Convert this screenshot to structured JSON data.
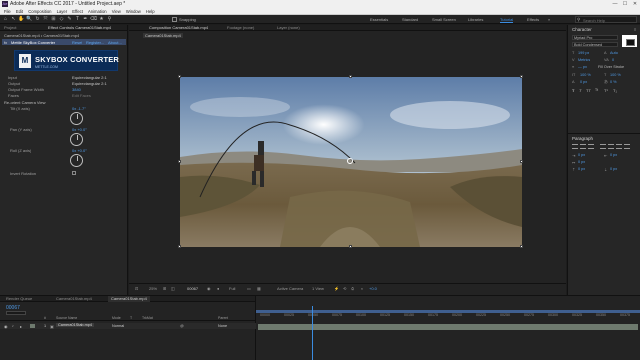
{
  "app": {
    "title": "Adobe After Effects CC 2017 - Untitled Project.aep *",
    "window_controls": [
      "—",
      "☐",
      "✕"
    ]
  },
  "menu": [
    "File",
    "Edit",
    "Composition",
    "Layer",
    "Effect",
    "Animation",
    "View",
    "Window",
    "Help"
  ],
  "toolbar": {
    "tools": [
      "⌂",
      "↖",
      "✋",
      "🔍",
      "↻",
      "⤧",
      "⊞",
      "◇",
      "✎",
      "T",
      "✒",
      "⌫",
      "★",
      "⚲"
    ],
    "snapping_label": "Snapping",
    "workspaces": [
      "Essentials",
      "Standard",
      "Small Screen",
      "Libraries",
      "Tutorial",
      "Effects"
    ],
    "active_workspace": "Tutorial",
    "search_placeholder": "Search Help"
  },
  "left_panel": {
    "tabs": [
      "Project",
      "Effect Controls  Camera01Stab.mp4"
    ],
    "breadcrumb": "Camera01Stab.mp4 • Camera01Stab.mp4",
    "effect_row": {
      "fx_label": "fx",
      "name": "Mettle SkyBox Converter",
      "reset": "Reset",
      "register": "Register...",
      "about": "About..."
    },
    "banner": {
      "title": "SKYBOX CONVERTER",
      "subtitle": "METTLE.COM"
    },
    "props": [
      {
        "label": "Input",
        "value": "Equirectangular 2:1"
      },
      {
        "label": "Output",
        "value": "Equirectangular 2:1"
      },
      {
        "label": "Output Frame Width",
        "value": "3840"
      },
      {
        "label": "Faces",
        "value": "Edit Faces"
      }
    ],
    "rotate": {
      "group_label": "Re-orient Camera View",
      "tilt_label": "Tilt (X axis)",
      "tilt_value": "0x -1.7°",
      "pan_label": "Pan (Y axis)",
      "pan_value": "0x +0.0°",
      "roll_label": "Roll (Z axis)",
      "roll_value": "0x +0.0°",
      "invert_label": "Invert Rotation"
    }
  },
  "viewer": {
    "tabs": [
      "Composition  Camera01Stab.mp4",
      "Footage (none)",
      "Layer (none)"
    ],
    "sub_tab": "Camera01Stab.mp4",
    "footer": {
      "zoom": "25%",
      "timecode": "00067",
      "resolution": "Full",
      "camera": "Active Camera",
      "views": "1 View",
      "exposure": "+0.0"
    }
  },
  "right_panel": {
    "character": {
      "title": "Character",
      "font": "Myriad Pro",
      "style": "Bold Condensed",
      "size": "199 px",
      "leading": "Auto",
      "tracking": "Metrics",
      "kerning": "0",
      "stroke": "— px",
      "stroke_mode": "Fill Over Stroke",
      "vscale": "100 %",
      "hscale": "100 %",
      "baseline": "0 px",
      "tsume": "0 %"
    },
    "paragraph": {
      "title": "Paragraph",
      "indent1": "0 px",
      "indent2": "0 px",
      "indent3": "0 px",
      "space1": "0 px",
      "space2": "0 px"
    }
  },
  "timeline": {
    "tabs": [
      "Render Queue",
      "Camera01Stab.mp4",
      "Camera01Stab.mp4"
    ],
    "timecode": "00067",
    "columns": [
      "#",
      "Source Name",
      "Mode",
      "T",
      "TrkMat",
      "Parent"
    ],
    "layer": {
      "index": "1",
      "name": "Camera01Stab.mp4",
      "mode": "Normal",
      "parent": "None"
    },
    "ruler": [
      "00000",
      "00025",
      "00050",
      "00075",
      "00100",
      "00125",
      "00150",
      "00175",
      "00200",
      "00225",
      "00250",
      "00275",
      "00300",
      "00325",
      "00350",
      "00375"
    ],
    "current_position_fraction": 0.146
  },
  "colors": {
    "accent": "#3b8ce0",
    "panel": "#262626",
    "background": "#1d1d1d",
    "layer_bar": "#6e7a6e"
  }
}
